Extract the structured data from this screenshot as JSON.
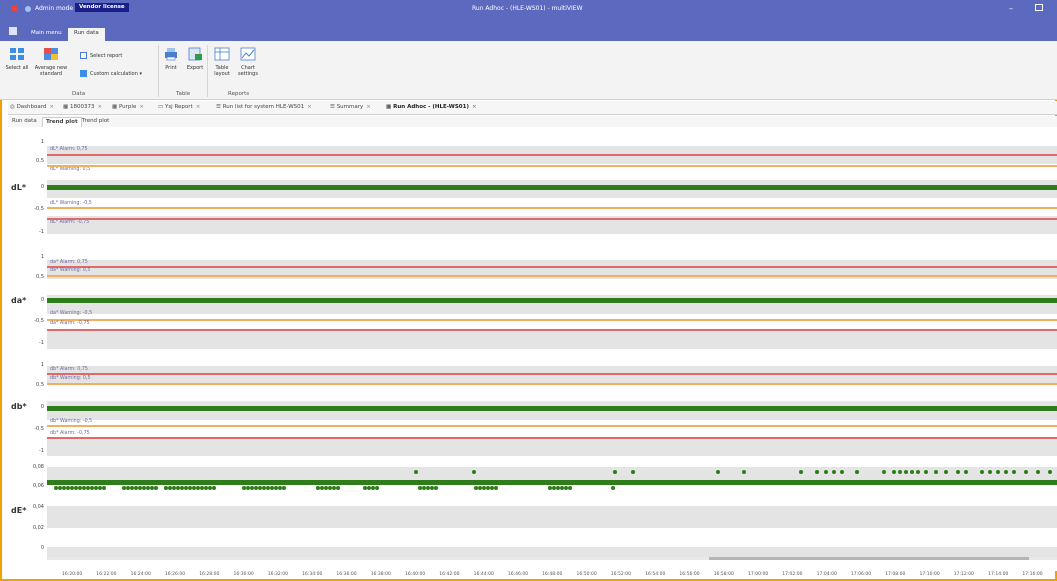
{
  "window": {
    "title": "Run Adhoc - (HLE-WS01) - multiVIEW",
    "admin_mode": "Admin mode",
    "vendor_license": "Vendor license"
  },
  "menu_tabs": [
    {
      "label": "Main menu",
      "active": false
    },
    {
      "label": "Run data",
      "active": true
    }
  ],
  "ribbon": {
    "select_all": "Select all",
    "average_new_standard": "Average new standard",
    "select_report": "Select report",
    "custom_calculation": "Custom calculation",
    "group_data": "Data",
    "print": "Print",
    "export": "Export",
    "group_table": "Table",
    "table_layout": "Table layout",
    "chart_settings": "Chart settings",
    "group_reports": "Reports"
  },
  "doc_tabs": [
    {
      "label": "Dashboard",
      "active": false
    },
    {
      "label": "1800373",
      "active": false
    },
    {
      "label": "Purple",
      "active": false
    },
    {
      "label": "Ysj Report",
      "active": false
    },
    {
      "label": "Run list for system HLE-WS01",
      "active": false
    },
    {
      "label": "Summary",
      "active": false
    },
    {
      "label": "Run Adhoc - (HLE-WS01)",
      "active": true
    }
  ],
  "sub_tabs": [
    {
      "label": "Run data",
      "active": false
    },
    {
      "label": "Trend plot",
      "active": true
    },
    {
      "label": "Trend plot",
      "active": false
    }
  ],
  "panels": [
    {
      "ylabel": "dL*",
      "ticks": [
        "1",
        "0,5",
        "0",
        "-0,5",
        "-1"
      ],
      "alarm_hi": "dL* Alarm: 0,75",
      "warn_hi": "dL* Warning: 0,5",
      "warn_lo": "dL* Warning: -0,5",
      "alarm_lo": "dL* Alarm: -0,75"
    },
    {
      "ylabel": "da*",
      "ticks": [
        "1",
        "0,5",
        "0",
        "-0,5",
        "-1"
      ],
      "alarm_hi": "da* Alarm: 0,75",
      "warn_hi": "da* Warning: 0,5",
      "warn_lo": "da* Warning: -0,5",
      "alarm_lo": "da* Alarm: -0,75"
    },
    {
      "ylabel": "db*",
      "ticks": [
        "1",
        "0,5",
        "0",
        "-0,5",
        "-1"
      ],
      "alarm_hi": "db* Alarm: 0,75",
      "warn_hi": "db* Warning: 0,5",
      "warn_lo": "db* Warning: -0,5",
      "alarm_lo": "db* Alarm: -0,75"
    },
    {
      "ylabel": "dE*",
      "ticks": [
        "0,08",
        "0,06",
        "0,04",
        "0,02",
        "0"
      ]
    }
  ],
  "x_ticks": [
    "16:20:00",
    "16:22:00",
    "16:24:00",
    "16:26:00",
    "16:28:00",
    "16:30:00",
    "16:32:00",
    "16:34:00",
    "16:36:00",
    "16:38:00",
    "16:40:00",
    "16:42:00",
    "16:44:00",
    "16:46:00",
    "16:48:00",
    "16:50:00",
    "16:52:00",
    "16:54:00",
    "16:56:00",
    "16:58:00",
    "17:00:00",
    "17:02:00",
    "17:04:00",
    "17:06:00",
    "17:08:00",
    "17:10:00",
    "17:12:00",
    "17:14:00",
    "17:16:00",
    "17:18:00"
  ],
  "colors": {
    "title_bar": "#5b6abf",
    "series": "#2e7d1a",
    "alarm_line": "#e06a6a",
    "warning_line": "#f0b060",
    "frame": "#f0a000"
  }
}
